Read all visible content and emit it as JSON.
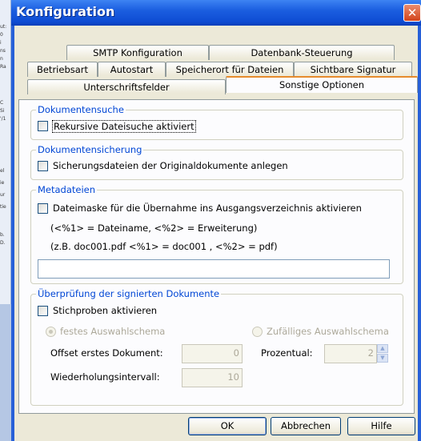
{
  "dialog": {
    "title": "Konfiguration"
  },
  "tabs": {
    "row1": [
      "SMTP Konfiguration",
      "Datenbank-Steuerung"
    ],
    "row2": [
      "Betriebsart",
      "Autostart",
      "Speicherort für Dateien",
      "Sichtbare Signatur"
    ],
    "row3": [
      "Unterschriftsfelder",
      "Sonstige Optionen"
    ]
  },
  "dokumentensuche": {
    "legend": "Dokumentensuche",
    "checkbox_label": "Rekursive Dateisuche aktiviert"
  },
  "dokumentensicherung": {
    "legend": "Dokumentensicherung",
    "checkbox_label": "Sicherungsdateien der Originaldokumente anlegen"
  },
  "metadateien": {
    "legend": "Metadateien",
    "checkbox_label": "Dateimaske für die Übernahme ins Ausgangsverzeichnis aktivieren",
    "hint1": "(<%1> = Dateiname, <%2> = Erweiterung)",
    "hint2": "(z.B. doc001.pdf <%1> = doc001 , <%2> = pdf)",
    "mask_value": ""
  },
  "pruefung": {
    "legend": "Überprüfung der signierten Dokumente",
    "checkbox_label": "Stichproben aktivieren",
    "radio_fixed": "festes Auswahlschema",
    "radio_random": "Zufälliges Auswahlschema",
    "offset_label": "Offset erstes Dokument:",
    "offset_value": "0",
    "percent_label": "Prozentual:",
    "percent_value": "2",
    "interval_label": "Wiederholungsintervall:",
    "interval_value": "10"
  },
  "buttons": {
    "ok": "OK",
    "cancel": "Abbrechen",
    "help": "Hilfe"
  }
}
